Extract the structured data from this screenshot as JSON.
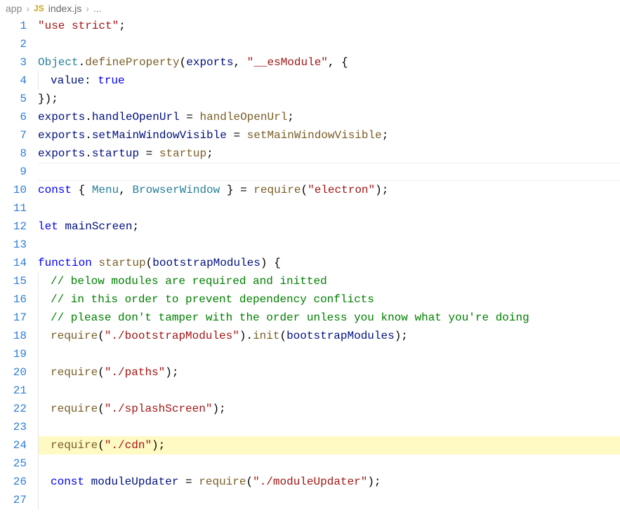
{
  "breadcrumb": {
    "folder": "app",
    "js_badge": "JS",
    "file": "index.js",
    "tail": "..."
  },
  "gutter": {
    "start": 1,
    "end": 27
  },
  "code": {
    "l1_str": "\"use strict\"",
    "l1_semi": ";",
    "l3_obj": "Object",
    "l3_dot1": ".",
    "l3_def": "defineProperty",
    "l3_paren_o": "(",
    "l3_exp": "exports",
    "l3_comma": ", ",
    "l3_es": "\"__esModule\"",
    "l3_comma2": ", {",
    "l4_val": "value",
    "l4_colon": ": ",
    "l4_true": "true",
    "l5": "});",
    "l6_p1": "exports",
    "l6_p2": ".",
    "l6_p3": "handleOpenUrl",
    "l6_p4": " = ",
    "l6_p5": "handleOpenUrl",
    "l6_p6": ";",
    "l7_p1": "exports",
    "l7_p2": ".",
    "l7_p3": "setMainWindowVisible",
    "l7_p4": " = ",
    "l7_p5": "setMainWindowVisible",
    "l7_p6": ";",
    "l8_p1": "exports",
    "l8_p2": ".",
    "l8_p3": "startup",
    "l8_p4": " = ",
    "l8_p5": "startup",
    "l8_p6": ";",
    "l10_const": "const",
    "l10_brace": " { ",
    "l10_menu": "Menu",
    "l10_c1": ", ",
    "l10_bw": "BrowserWindow",
    "l10_brace2": " } = ",
    "l10_req": "require",
    "l10_po": "(",
    "l10_el": "\"electron\"",
    "l10_pc": ");",
    "l12_let": "let",
    "l12_sp": " ",
    "l12_ms": "mainScreen",
    "l12_sc": ";",
    "l14_fn": "function",
    "l14_sp": " ",
    "l14_su": "startup",
    "l14_po": "(",
    "l14_bm": "bootstrapModules",
    "l14_pc": ") {",
    "l15_c": "// below modules are required and initted",
    "l16_c": "// in this order to prevent dependency conflicts",
    "l17_c": "// please don't tamper with the order unless you know what you're doing",
    "l18_r": "require",
    "l18_po": "(",
    "l18_s": "\"./bootstrapModules\"",
    "l18_pc": ").",
    "l18_init": "init",
    "l18_po2": "(",
    "l18_bm": "bootstrapModules",
    "l18_pc2": ");",
    "l20_r": "require",
    "l20_po": "(",
    "l20_s": "\"./paths\"",
    "l20_pc": ");",
    "l22_r": "require",
    "l22_po": "(",
    "l22_s": "\"./splashScreen\"",
    "l22_pc": ");",
    "l24_r": "require",
    "l24_po": "(",
    "l24_s": "\"./cdn\"",
    "l24_pc": ");",
    "l26_const": "const",
    "l26_sp": " ",
    "l26_mu": "moduleUpdater",
    "l26_eq": " = ",
    "l26_r": "require",
    "l26_po": "(",
    "l26_s": "\"./moduleUpdater\"",
    "l26_pc": ");"
  }
}
